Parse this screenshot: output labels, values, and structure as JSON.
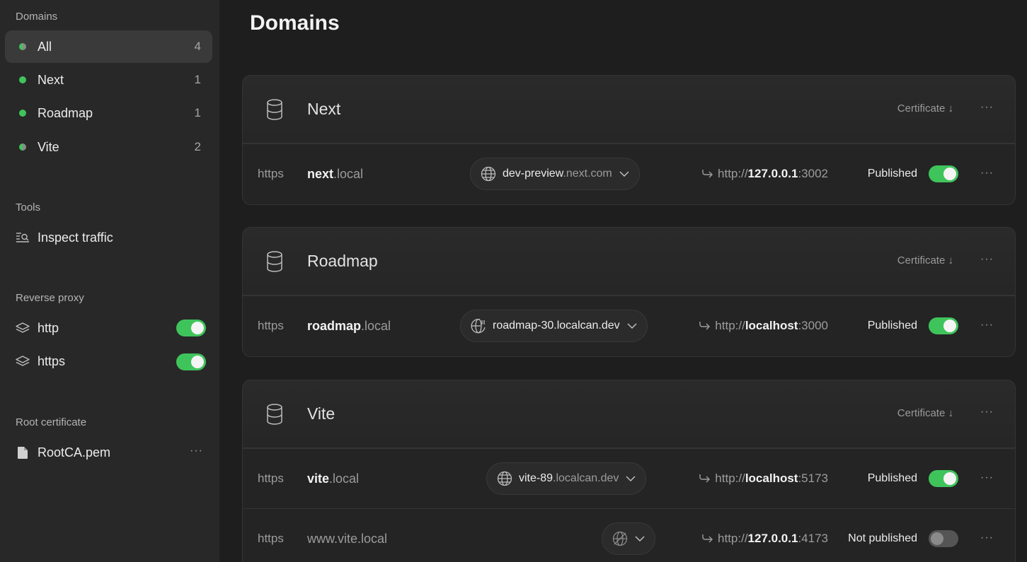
{
  "sidebar": {
    "domains_title": "Domains",
    "domains": [
      {
        "label": "All",
        "count": "4"
      },
      {
        "label": "Next",
        "count": "1"
      },
      {
        "label": "Roadmap",
        "count": "1"
      },
      {
        "label": "Vite",
        "count": "2"
      }
    ],
    "tools_title": "Tools",
    "tools": [
      {
        "label": "Inspect traffic"
      }
    ],
    "proxy_title": "Reverse proxy",
    "proxy": [
      {
        "label": "http",
        "enabled": true
      },
      {
        "label": "https",
        "enabled": true
      }
    ],
    "rootcert_title": "Root certificate",
    "rootcert_file": "RootCA.pem"
  },
  "main": {
    "title": "Domains",
    "certificate_label": "Certificate ↓",
    "groups": [
      {
        "name": "Next",
        "rows": [
          {
            "proto": "https",
            "host_main": "next",
            "host_suffix": ".local",
            "share_main": "dev-preview",
            "share_suffix": ".next.com",
            "target_prefix": "http://",
            "target_host": "127.0.0.1",
            "target_port": ":3002",
            "status": "Published",
            "published": true
          }
        ]
      },
      {
        "name": "Roadmap",
        "rows": [
          {
            "proto": "https",
            "host_main": "roadmap",
            "host_suffix": ".local",
            "share_main": "roadmap-30.localcan.dev",
            "share_suffix": "",
            "target_prefix": "http://",
            "target_host": "localhost",
            "target_port": ":3000",
            "status": "Published",
            "published": true
          }
        ]
      },
      {
        "name": "Vite",
        "rows": [
          {
            "proto": "https",
            "host_main": "vite",
            "host_suffix": ".local",
            "share_main": "vite-89",
            "share_suffix": ".localcan.dev",
            "target_prefix": "http://",
            "target_host": "localhost",
            "target_port": ":5173",
            "status": "Published",
            "published": true
          },
          {
            "proto": "https",
            "host_main": "",
            "host_suffix": "www.vite.local",
            "share_main": "",
            "share_suffix": "",
            "target_prefix": "http://",
            "target_host": "127.0.0.1",
            "target_port": ":4173",
            "status": "Not published",
            "published": false
          }
        ]
      }
    ]
  },
  "colors": {
    "accent_green": "#3fc45c",
    "background": "#1e1e1e",
    "sidebar": "#282828"
  }
}
